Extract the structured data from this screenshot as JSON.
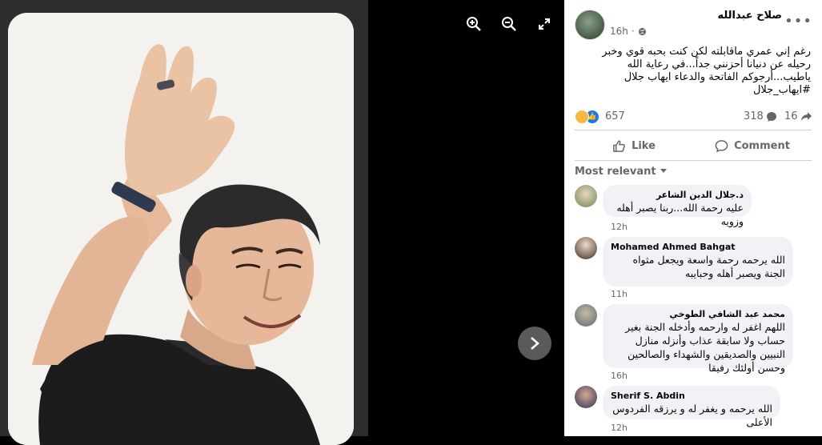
{
  "viewer": {
    "tools": [
      {
        "icon": "zoom-in-icon"
      },
      {
        "icon": "zoom-out-icon"
      },
      {
        "icon": "fullscreen-icon"
      }
    ],
    "next_icon": "chevron-right-icon"
  },
  "post": {
    "author": "صلاح عبدالله",
    "time": "16h",
    "privacy_icon": "globe-icon",
    "text": "رغم إني عمري ماقابلته لكن كنت بحبه قوي وخبر رحيله عن دنيانا أحزنني جداً...في رعاية الله ياطيب...أرجوكم الفاتحة والدعاء ايهاب جلال #ايهاب_جلال",
    "reactions_count": "657",
    "comments_count": "318",
    "shares_count": "16"
  },
  "actions": {
    "like": "Like",
    "comment": "Comment"
  },
  "sort_label": "Most relevant",
  "comments": [
    {
      "name": "د.جلال الدين الشاعر",
      "text": "عليه رحمة الله...ربنا يصبر أهله وزويه",
      "time": "12h"
    },
    {
      "name": "Mohamed Ahmed Bahgat",
      "text": "الله يرحمه رحمة واسعة ويجعل مثواه الجنة ويصبر أهله وحبايبه",
      "time": "11h"
    },
    {
      "name": "محمد عبد الشافي الطوخي",
      "text": "اللهم اغفر له وارحمه وأدخله الجنة بغير حساب ولا سابقة عذاب وأنزله منازل النبيين والصديقين والشهداء والصالحين وحسن أولئك رفيقا",
      "time": "16h"
    },
    {
      "name": "Sherif S. Abdin",
      "text": "الله يرحمه و يغفر له و يرزقه الفردوس الأعلى",
      "time": "12h"
    }
  ],
  "colors": {
    "accent": "#1877f2",
    "secondary_text": "#65676b",
    "bubble": "#f0f2f5"
  }
}
